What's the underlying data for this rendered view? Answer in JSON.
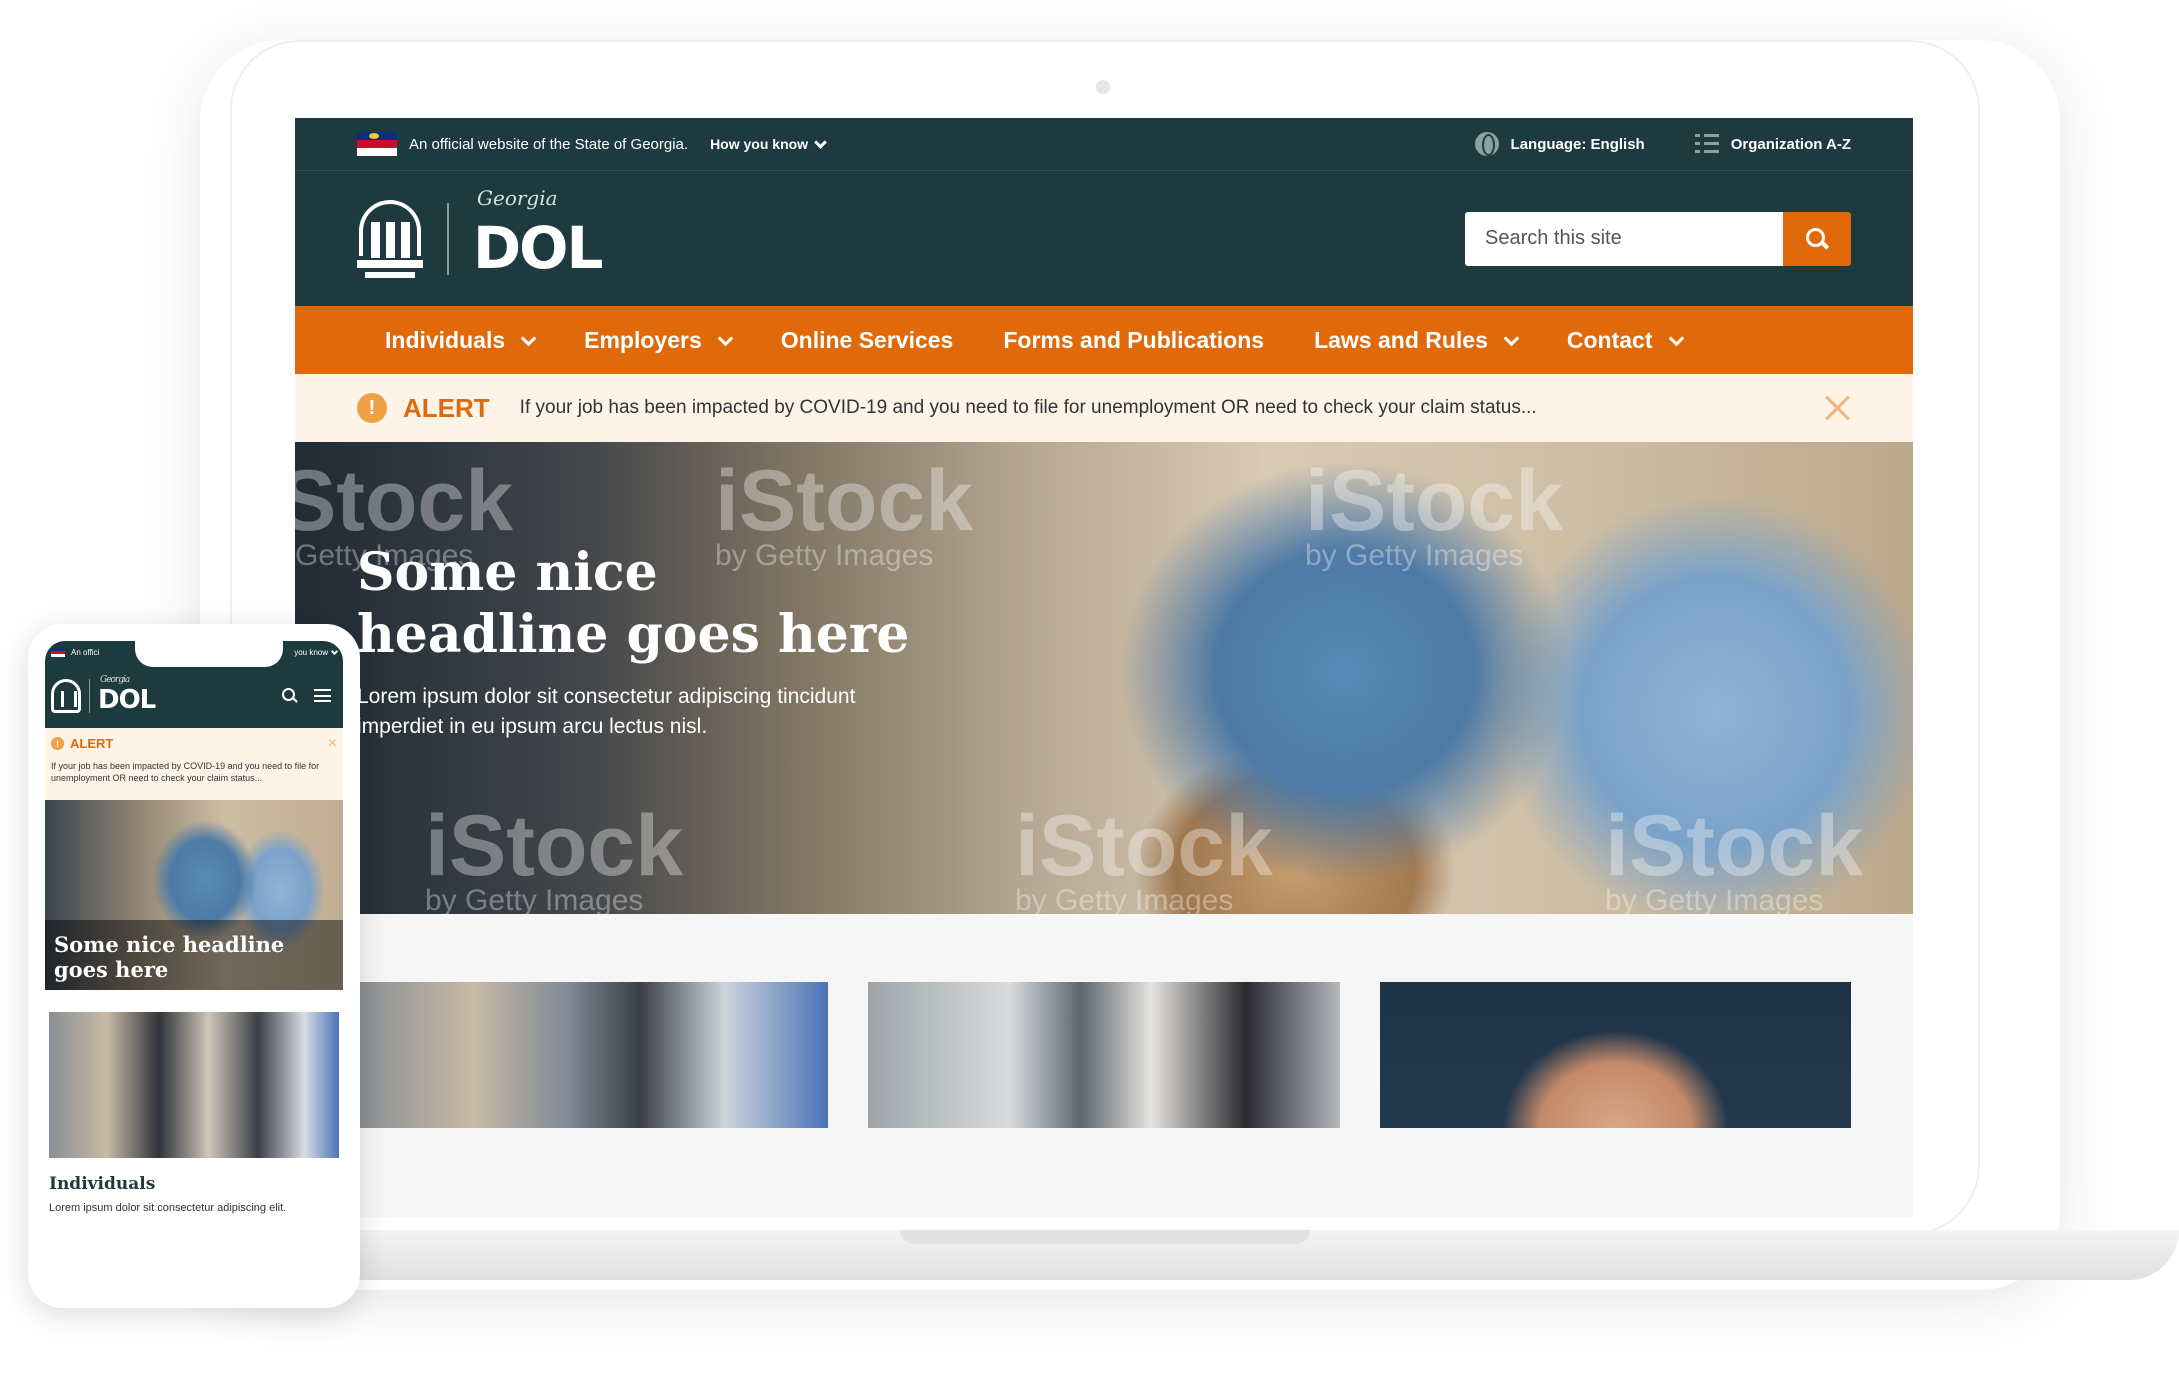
{
  "desktop": {
    "gov_bar": {
      "official_text": "An official website of the State of Georgia.",
      "how_you_know": "How you know",
      "language": "Language: English",
      "org_az": "Organization A-Z"
    },
    "header": {
      "logo_script": "Georgia",
      "logo_text": "DOL",
      "search_placeholder": "Search this site"
    },
    "nav": [
      {
        "label": "Individuals",
        "has_dropdown": true
      },
      {
        "label": "Employers",
        "has_dropdown": true
      },
      {
        "label": "Online Services",
        "has_dropdown": false
      },
      {
        "label": "Forms and Publications",
        "has_dropdown": false
      },
      {
        "label": "Laws and Rules",
        "has_dropdown": true
      },
      {
        "label": "Contact",
        "has_dropdown": true
      }
    ],
    "alert": {
      "title": "ALERT",
      "message": "If your job has been impacted by COVID-19 and you need to file for unemployment OR need to check your claim status..."
    },
    "hero": {
      "headline": "Some nice headline goes here",
      "subtext": "Lorem ipsum dolor sit consectetur adipiscing tincidunt imperdiet in eu ipsum arcu lectus nisl.",
      "watermark": "iStock",
      "watermark_sub": "by Getty Images"
    }
  },
  "mobile": {
    "gov_left": "An offici",
    "gov_right": "you know",
    "logo_script": "Georgia",
    "logo_text": "DOL",
    "alert_title": "ALERT",
    "alert_message": "If your job has been impacted by COVID-19 and you need to file for unemployment OR need to check your claim status...",
    "hero_headline": "Some nice headline goes here",
    "card_title": "Individuals",
    "card_text": "Lorem ipsum dolor sit consectetur adipiscing elit."
  },
  "colors": {
    "dark_teal": "#1d3b3e",
    "orange": "#e06a0a",
    "alert_bg": "#fdf3e7"
  },
  "icons": [
    "georgia-flag-icon",
    "chevron-down-icon",
    "globe-icon",
    "list-icon",
    "search-icon",
    "alert-icon",
    "close-icon",
    "menu-icon",
    "georgia-seal-icon"
  ]
}
